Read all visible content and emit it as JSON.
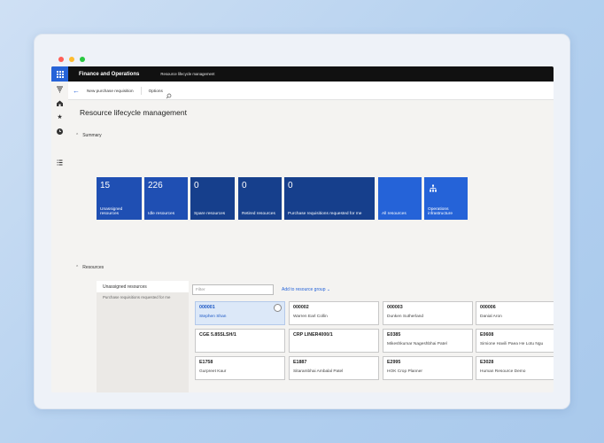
{
  "window": {
    "dots": [
      "#ff5f57",
      "#febc2e",
      "#28c840"
    ]
  },
  "topbar": {
    "app_title": "Finance and Operations",
    "breadcrumb": "Resource lifecycle management"
  },
  "actionbar": {
    "new_req": "New purchase requisition",
    "options": "Options"
  },
  "page": {
    "title": "Resource lifecycle management"
  },
  "summary": {
    "header": "Summary",
    "tiles": [
      {
        "count": "15",
        "label": "Unassigned resources",
        "color": "#1f4fb3"
      },
      {
        "count": "226",
        "label": "Idle resources",
        "color": "#1f4fb3"
      },
      {
        "count": "0",
        "label": "Spare resources",
        "color": "#163f8c"
      },
      {
        "count": "0",
        "label": "Retired resources",
        "color": "#163f8c"
      },
      {
        "count": "0",
        "label": "Purchase requisitions requested for me",
        "color": "#163f8c"
      },
      {
        "count": "",
        "label": "All resources",
        "color": "#2563d8"
      },
      {
        "count": "",
        "label": "Operations infrastructure",
        "color": "#2563d8",
        "icon": "org-chart-icon"
      }
    ]
  },
  "resources": {
    "header": "Resources",
    "left_items": [
      "Unassigned resources",
      "Purchase requisitions requested for me"
    ],
    "filter_placeholder": "Filter",
    "add_group": "Add to resource group",
    "cards": [
      {
        "id": "000001",
        "name": "Stephen Shan",
        "selected": true
      },
      {
        "id": "000002",
        "name": "Warren Earl Collin"
      },
      {
        "id": "000003",
        "name": "Dunken Sutherland"
      },
      {
        "id": "000006",
        "name": "Danial Aron"
      },
      {
        "id": "CGE 5.85SLSH/1",
        "name": ""
      },
      {
        "id": "CRP LINER4000/1",
        "name": ""
      },
      {
        "id": "E0385",
        "name": "Mikeshkumar Nageshbhai Patel"
      },
      {
        "id": "E0608",
        "name": "Simione Havili Paea He Lotu Ngu"
      },
      {
        "id": "E1758",
        "name": "Gurpreet Kaur"
      },
      {
        "id": "E1887",
        "name": "Sitarambhai Ambalal Patel"
      },
      {
        "id": "E2995",
        "name": "HOK Crop Planner"
      },
      {
        "id": "E3028",
        "name": "Human Resource Demo"
      }
    ]
  }
}
